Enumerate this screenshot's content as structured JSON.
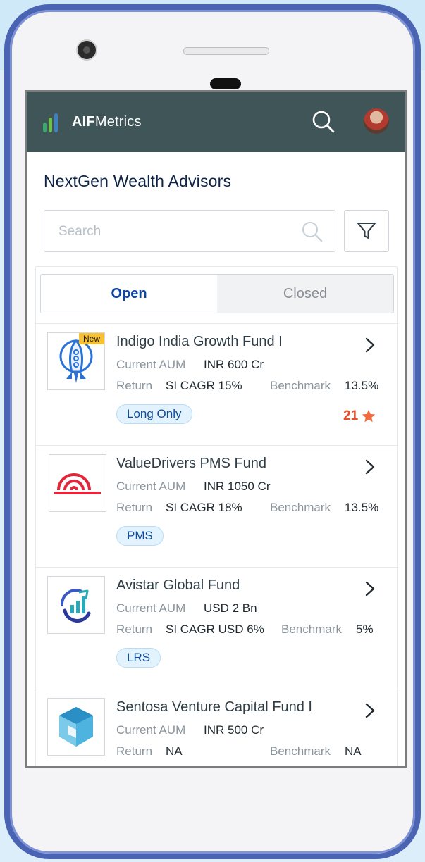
{
  "app": {
    "logo_brand": "AIF",
    "logo_suffix": "Metrics"
  },
  "page": {
    "title": "NextGen Wealth Advisors"
  },
  "search": {
    "placeholder": "Search"
  },
  "tabs": {
    "open_label": "Open",
    "closed_label": "Closed",
    "active": "Open"
  },
  "funds": [
    {
      "name": "Indigo India Growth Fund I",
      "badge": "New",
      "aum_label": "Current AUM",
      "aum_value": "INR 600 Cr",
      "return_label": "Return",
      "return_value": "SI CAGR 15%",
      "benchmark_label": "Benchmark",
      "benchmark_value": "13.5%",
      "tag": "Long Only",
      "rating": "21",
      "logo": "rocket-icon"
    },
    {
      "name": "ValueDrivers PMS Fund",
      "aum_label": "Current AUM",
      "aum_value": "INR 1050 Cr",
      "return_label": "Return",
      "return_value": "SI CAGR 18%",
      "benchmark_label": "Benchmark",
      "benchmark_value": "13.5%",
      "tag": "PMS",
      "logo": "arc-logo-icon"
    },
    {
      "name": "Avistar Global Fund",
      "aum_label": "Current AUM",
      "aum_value": "USD 2 Bn",
      "return_label": "Return",
      "return_value": "SI CAGR USD 6%",
      "benchmark_label": "Benchmark",
      "benchmark_value": "5%",
      "tag": "LRS",
      "logo": "growth-swirl-icon"
    },
    {
      "name": "Sentosa Venture Capital Fund I",
      "aum_label": "Current AUM",
      "aum_value": "INR 500 Cr",
      "return_label": "Return",
      "return_value": "NA",
      "benchmark_label": "Benchmark",
      "benchmark_value": "NA",
      "logo": "cube-icon"
    }
  ],
  "colors": {
    "appbar": "#3f5558",
    "accent": "#0d47a1",
    "rating": "#e6512c",
    "tag_bg": "#e3f3fd"
  }
}
